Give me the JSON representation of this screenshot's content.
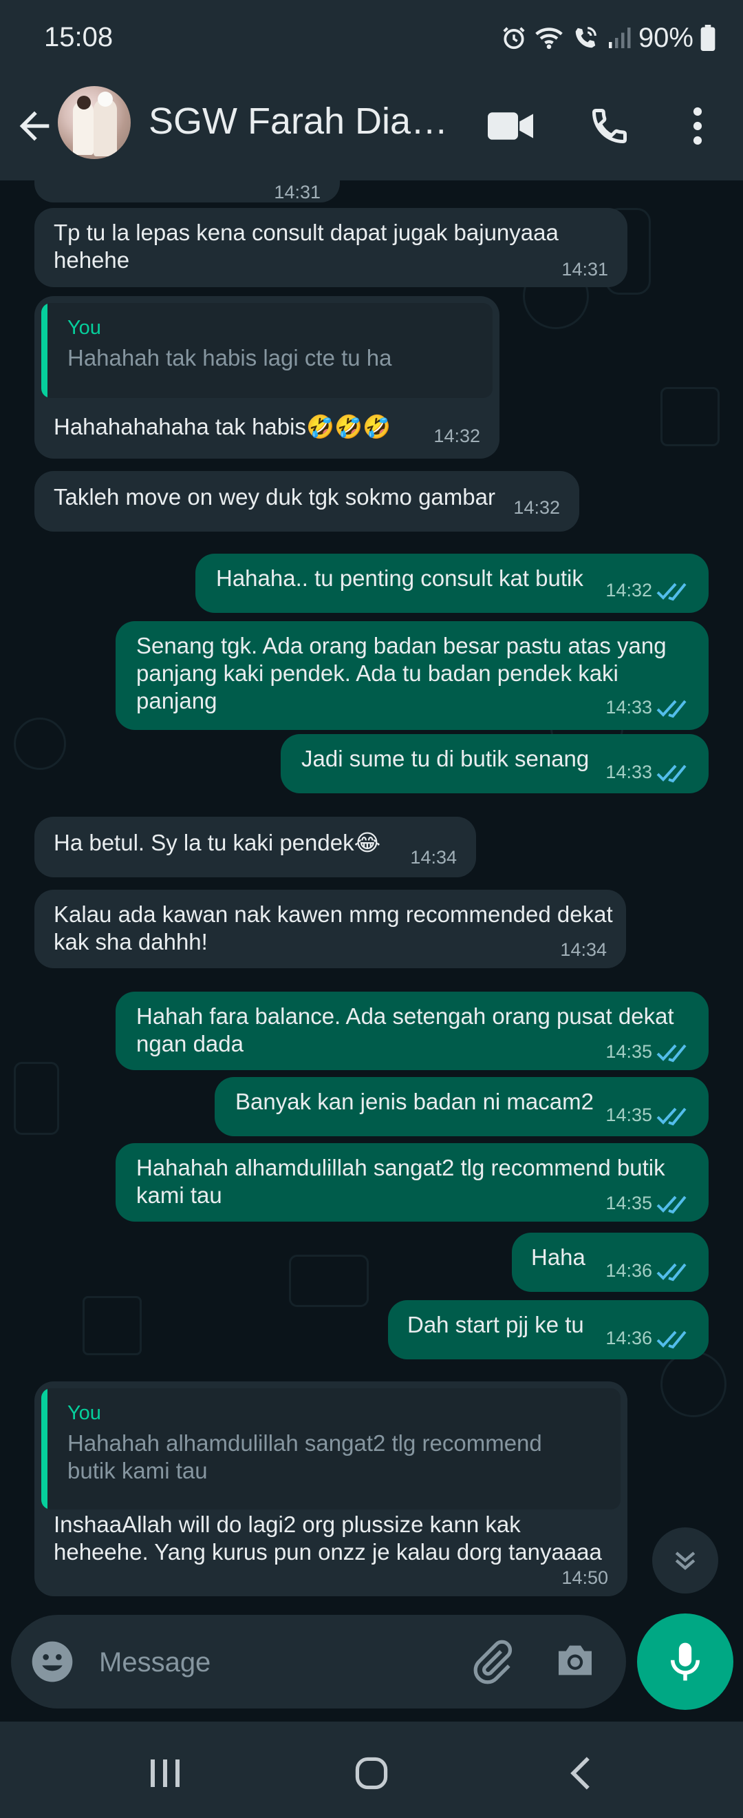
{
  "status_bar": {
    "time": "15:08",
    "battery": "90%"
  },
  "header": {
    "contact_name": "SGW Farah Diana..."
  },
  "messages": [
    {
      "dir": "in",
      "text": "Tp tu la lepas kena consult dapat jugak bajunyaaa\nhehehe",
      "time": "14:31"
    },
    {
      "dir": "in",
      "quote_author": "You",
      "quote_text": "Hahahah tak habis lagi cte tu ha",
      "text": "Hahahahahaha tak habis🤣🤣🤣",
      "time": "14:32"
    },
    {
      "dir": "in",
      "text": "Takleh move on wey duk tgk sokmo gambar",
      "time": "14:32"
    },
    {
      "dir": "out",
      "text": "Hahaha.. tu penting consult kat butik",
      "time": "14:32"
    },
    {
      "dir": "out",
      "text": "Senang tgk. Ada orang badan besar pastu atas yang\npanjang kaki pendek. Ada tu badan pendek kaki\npanjang",
      "time": "14:33"
    },
    {
      "dir": "out",
      "text": "Jadi sume tu di butik senang",
      "time": "14:33"
    },
    {
      "dir": "in",
      "text": "Ha betul. Sy la tu kaki pendek😂",
      "time": "14:34"
    },
    {
      "dir": "in",
      "text": "Kalau ada kawan nak kawen mmg recommended dekat\nkak sha dahhh!",
      "time": "14:34"
    },
    {
      "dir": "out",
      "text": "Hahah fara balance. Ada setengah orang pusat dekat\nngan dada",
      "time": "14:35"
    },
    {
      "dir": "out",
      "text": "Banyak kan jenis badan ni macam2",
      "time": "14:35"
    },
    {
      "dir": "out",
      "text": "Hahahah alhamdulillah sangat2 tlg recommend butik\nkami tau",
      "time": "14:35"
    },
    {
      "dir": "out",
      "text": "Haha",
      "time": "14:36"
    },
    {
      "dir": "out",
      "text": "Dah start pjj ke tu",
      "time": "14:36"
    },
    {
      "dir": "in",
      "quote_author": "You",
      "quote_text": "Hahahah alhamdulillah sangat2 tlg recommend\nbutik kami tau",
      "text": "InshaaAllah will do lagi2 org plussize kann kak\nheheehe. Yang kurus pun onzz je kalau dorg tanyaaaa",
      "time": "14:50"
    }
  ],
  "partial_top_time": "14:31",
  "composer": {
    "placeholder": "Message"
  },
  "icons": {
    "back": "arrow-left-icon",
    "video": "video-call-icon",
    "call": "phone-icon",
    "menu": "more-vert-icon",
    "emoji": "emoji-icon",
    "attach": "paperclip-icon",
    "camera": "camera-icon",
    "mic": "mic-icon",
    "scroll": "chevron-double-down-icon",
    "read_receipt": "double-check-icon"
  },
  "colors": {
    "background": "#0b141a",
    "bar": "#1f2c34",
    "incoming": "#1f2c34",
    "outgoing": "#005c4b",
    "accent": "#00a884",
    "read_tick": "#53bdeb",
    "quote_author": "#06cf9c"
  }
}
